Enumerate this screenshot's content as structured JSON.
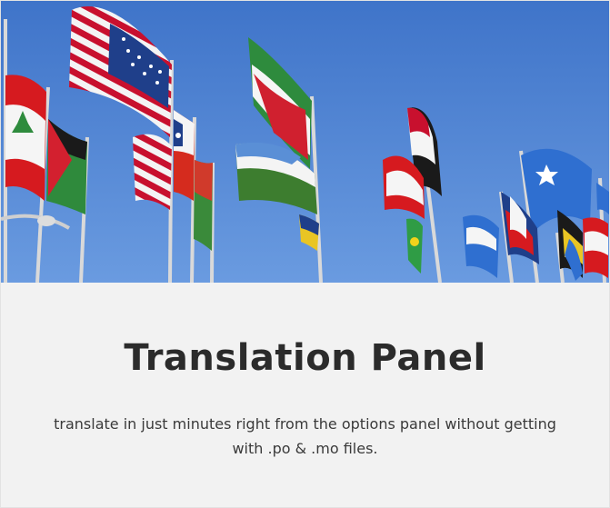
{
  "card": {
    "title": "Translation Panel",
    "description": "translate in just minutes right from the options panel without getting with .po & .mo files."
  },
  "hero_image": {
    "subject": "flags-of-nations",
    "sky_color": "#4a7fd0"
  }
}
